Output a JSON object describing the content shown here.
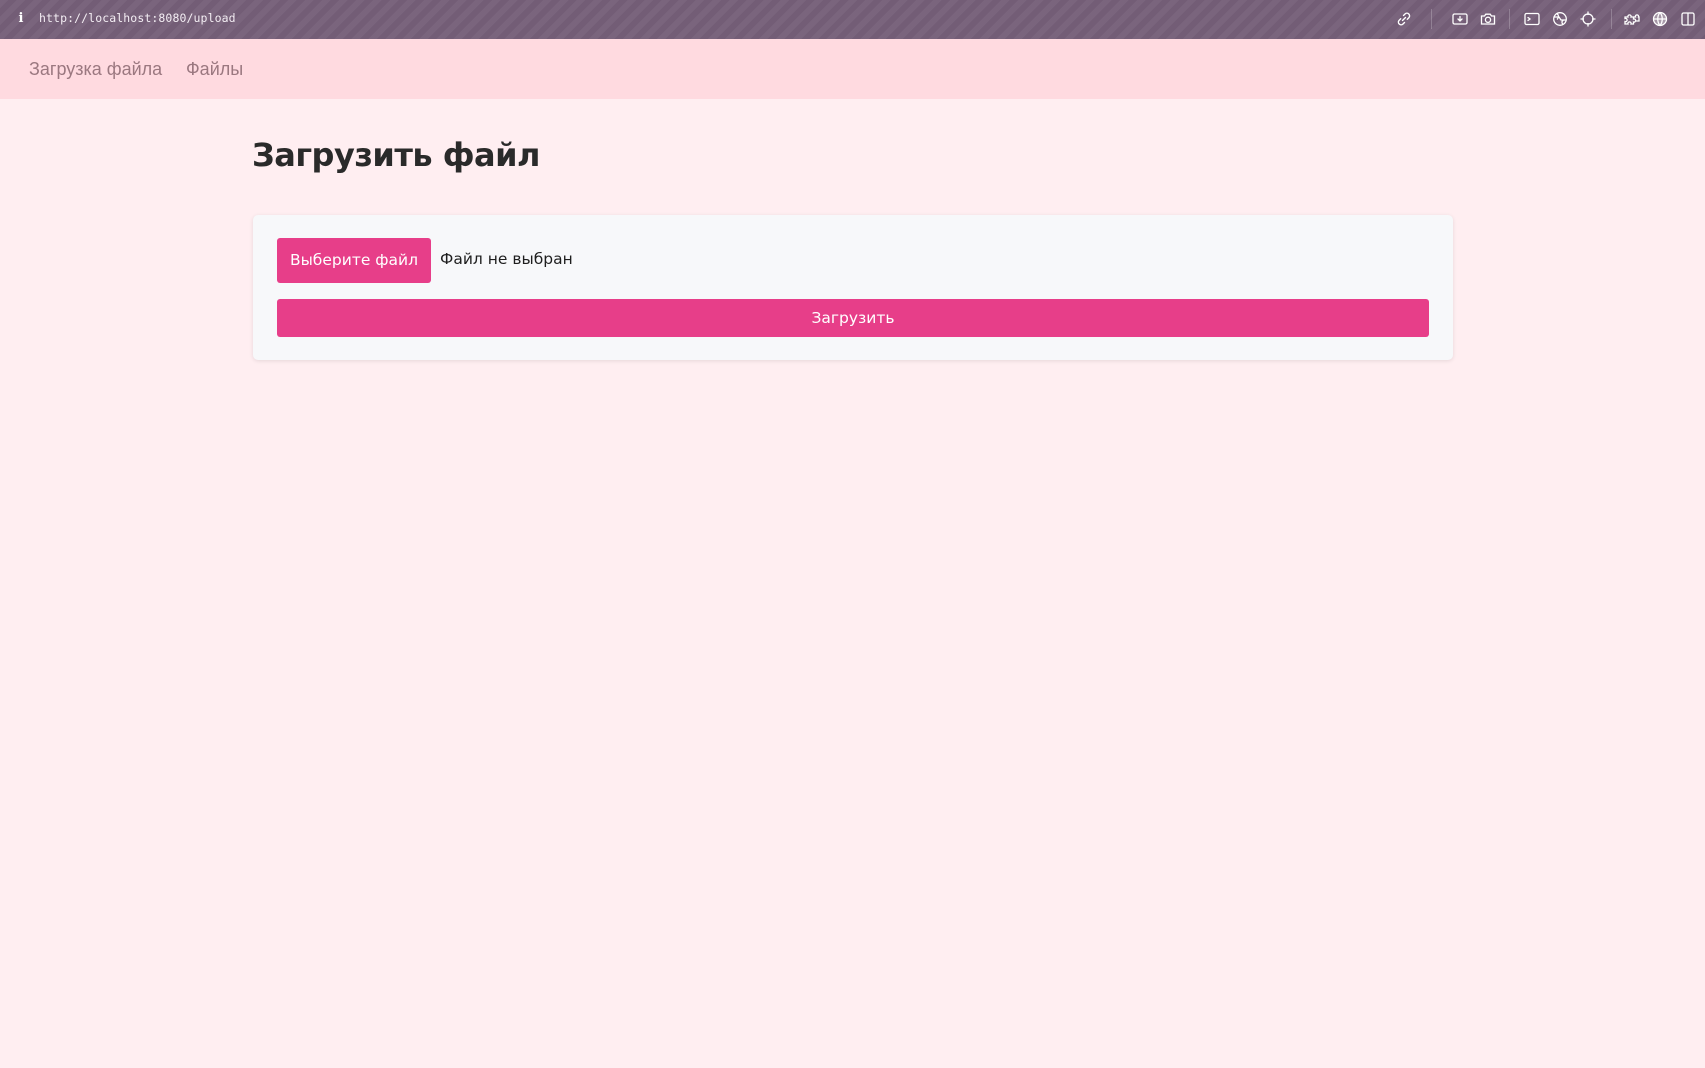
{
  "browser": {
    "url": "http://localhost:8080/upload",
    "icons": [
      "info-icon",
      "link-icon",
      "screenshot-icon",
      "camera-icon",
      "terminal-icon",
      "globe-icon",
      "crosshair-icon",
      "extension-icon",
      "language-icon",
      "sidebar-icon"
    ]
  },
  "nav": {
    "items": [
      {
        "label": "Загрузка файла"
      },
      {
        "label": "Файлы"
      }
    ]
  },
  "main": {
    "title": "Загрузить файл",
    "choose_button_label": "Выберите файл",
    "file_status": "Файл не выбран",
    "upload_button_label": "Загрузить"
  },
  "colors": {
    "accent": "#e73e89",
    "page_background": "#ffeef1",
    "nav_background": "#ffdae0",
    "browser_bar": "#755f78"
  }
}
